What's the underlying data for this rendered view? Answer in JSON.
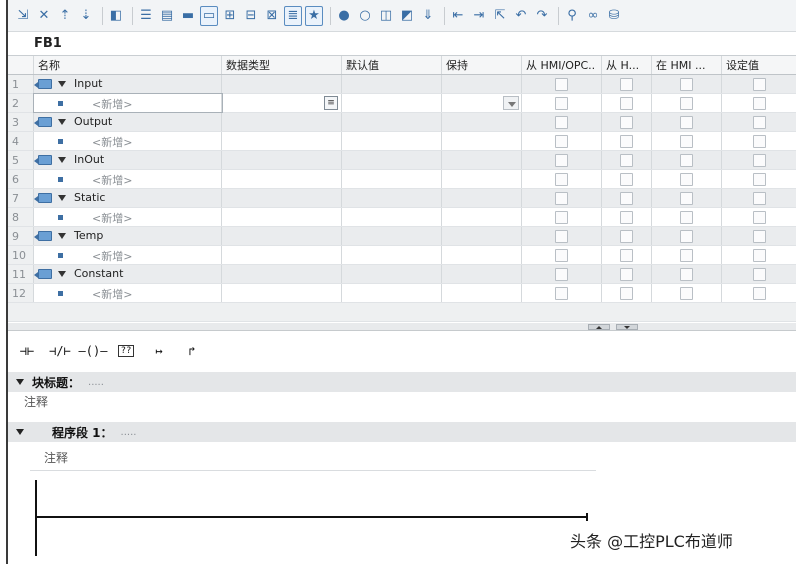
{
  "toolbar": {
    "icons": [
      "insert-row-icon",
      "delete-row-icon",
      "insert-pin-icon",
      "remove-pin-icon",
      "monitor-icon",
      "indent-icon",
      "block-icon",
      "fields-icon",
      "comment-icon",
      "expand-icon",
      "collapse-icon",
      "network-expand-icon",
      "list-icon",
      "favorites-icon",
      "breakpoint-set-icon",
      "breakpoint-clear-icon",
      "snapshot-icon",
      "snapshot-load-icon",
      "compile-icon",
      "go-to-icon",
      "step-in-icon",
      "step-out-icon",
      "first-icon",
      "next-icon",
      "connect-icon",
      "disconnect-icon",
      "load-icon"
    ]
  },
  "block": {
    "name": "FB1"
  },
  "table": {
    "columns": [
      "名称",
      "数据类型",
      "默认值",
      "保持",
      "从 HMI/OPC..",
      "从 H...",
      "在 HMI ...",
      "设定值"
    ],
    "rows": [
      {
        "num": "1",
        "kind": "section",
        "label": "Input"
      },
      {
        "num": "2",
        "kind": "placeholder",
        "label": "<新增>",
        "editing": true
      },
      {
        "num": "3",
        "kind": "section",
        "label": "Output"
      },
      {
        "num": "4",
        "kind": "placeholder",
        "label": "<新增>"
      },
      {
        "num": "5",
        "kind": "section",
        "label": "InOut"
      },
      {
        "num": "6",
        "kind": "placeholder",
        "label": "<新增>"
      },
      {
        "num": "7",
        "kind": "section",
        "label": "Static"
      },
      {
        "num": "8",
        "kind": "placeholder",
        "label": "<新增>"
      },
      {
        "num": "9",
        "kind": "section",
        "label": "Temp"
      },
      {
        "num": "10",
        "kind": "placeholder",
        "label": "<新增>"
      },
      {
        "num": "11",
        "kind": "section",
        "label": "Constant"
      },
      {
        "num": "12",
        "kind": "placeholder",
        "label": "<新增>"
      }
    ]
  },
  "lad_palette": {
    "items": [
      {
        "glyph": "⊣⊢",
        "icon": "normally-open-contact-icon"
      },
      {
        "glyph": "⊣/⊢",
        "icon": "normally-closed-contact-icon"
      },
      {
        "glyph": "–()–",
        "icon": "coil-icon"
      },
      {
        "glyph": "??",
        "icon": "empty-box-icon"
      },
      {
        "glyph": "↦",
        "icon": "open-branch-icon"
      },
      {
        "glyph": "↱",
        "icon": "close-branch-icon"
      }
    ]
  },
  "block_title": {
    "label": "块标题：",
    "dots": ".....",
    "comment": "注释"
  },
  "network": {
    "label": "程序段 1：",
    "dots": ".....",
    "comment": "注释"
  },
  "watermark": "头条 @工控PLC布道师"
}
